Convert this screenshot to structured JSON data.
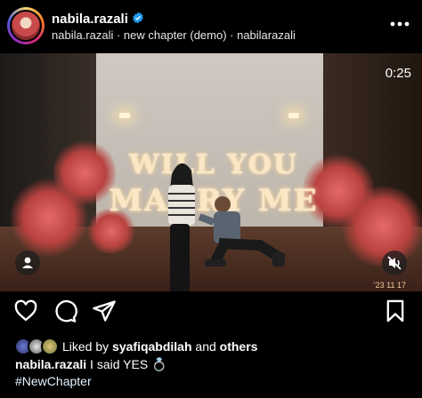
{
  "post": {
    "username": "nabila.razali",
    "subtitle": "nabila.razali · new chapter (demo) · nabilarazali",
    "media": {
      "sign_line1": "WILL YOU",
      "sign_line2": "MARRY ME",
      "timer": "0:25",
      "timestamp": "'23 11 17"
    },
    "likes": {
      "prefix": "Liked by",
      "user": "syafiqabdilah",
      "middle": "and",
      "suffix": "others"
    },
    "caption": {
      "username": "nabila.razali",
      "text": "I said YES 💍",
      "hashtag": "#NewChapter"
    }
  },
  "colors": {
    "background": "#000000",
    "text": "#ffffff",
    "verified": "#1d9bf0",
    "hashtag": "#e0f1ff"
  },
  "icons": [
    "avatar",
    "verified-icon",
    "more-icon",
    "user-tag-icon",
    "mute-icon",
    "heart-icon",
    "comment-icon",
    "share-icon",
    "bookmark-icon",
    "ring-icon"
  ]
}
